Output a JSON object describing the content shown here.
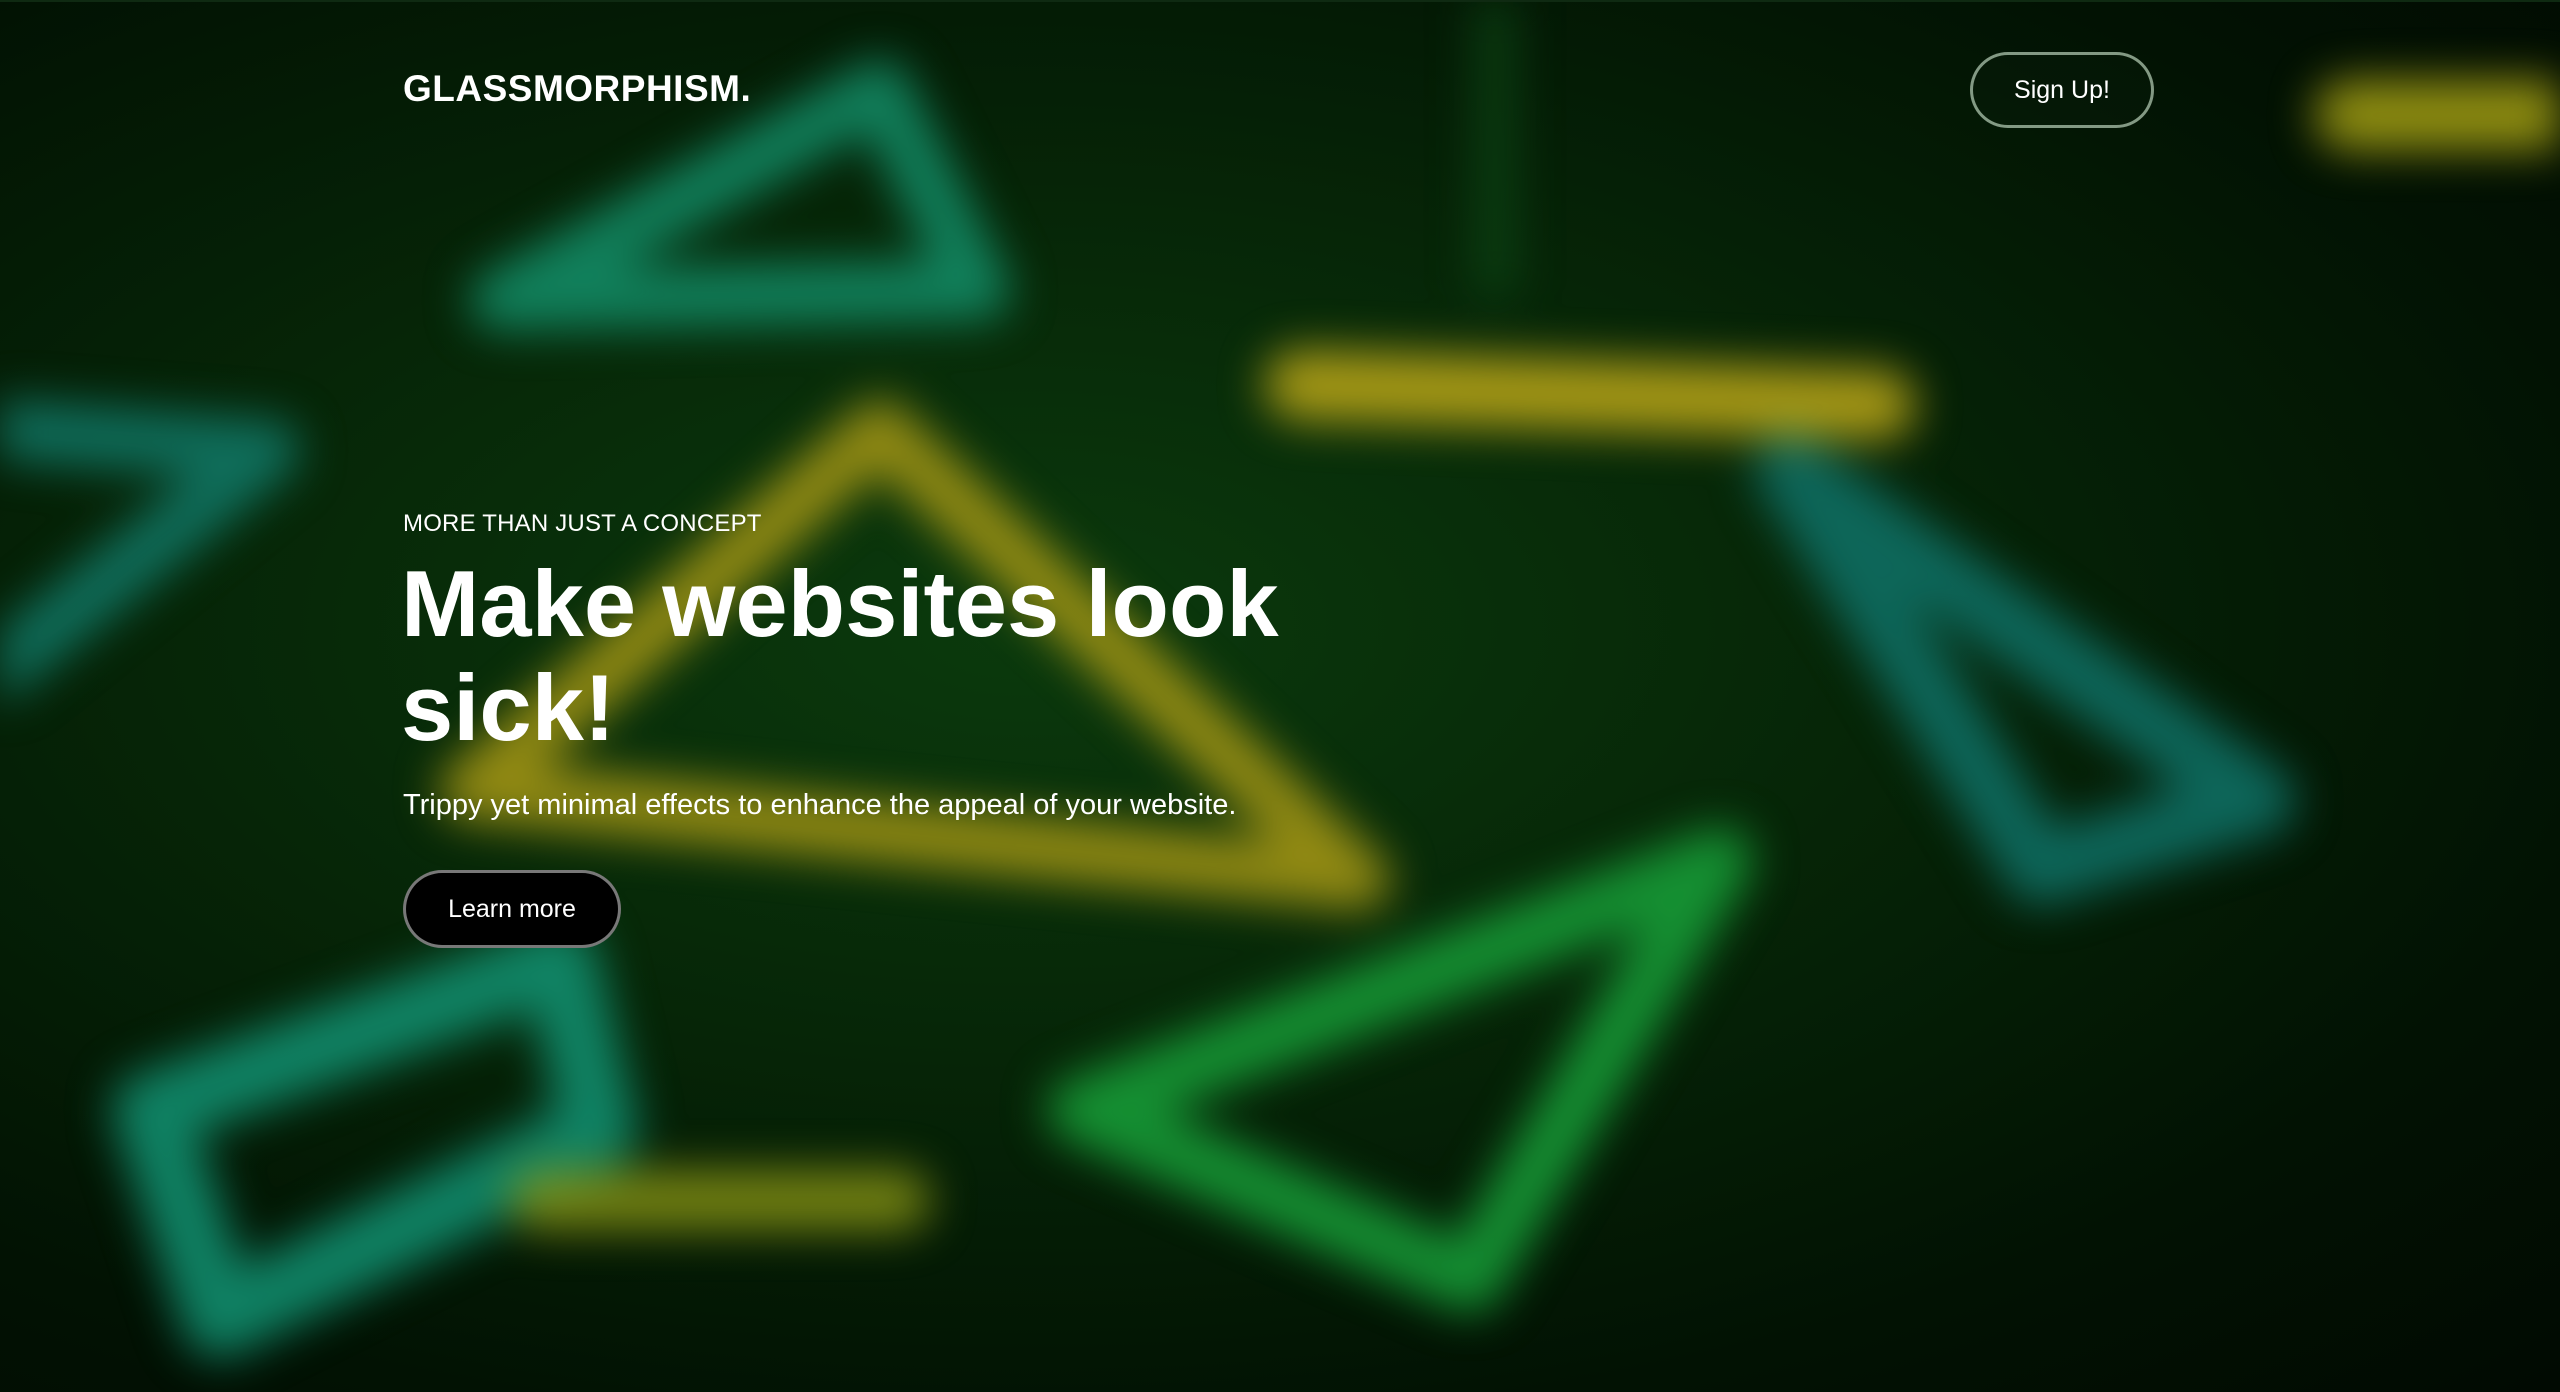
{
  "header": {
    "logo": "GLASSMORPHISM.",
    "signup_label": "Sign Up!"
  },
  "hero": {
    "eyebrow": "MORE THAN JUST A CONCEPT",
    "headline_line1": "Make websites look",
    "headline_line2": "sick!",
    "subtext": "Trippy yet minimal effects to enhance the appeal of your website.",
    "cta_label": "Learn more"
  },
  "colors": {
    "background": "#031a05",
    "teal": "#12a37a",
    "green": "#1fae3a",
    "yellow": "#c9b21a",
    "text": "#ffffff",
    "cta_background": "#000000"
  }
}
